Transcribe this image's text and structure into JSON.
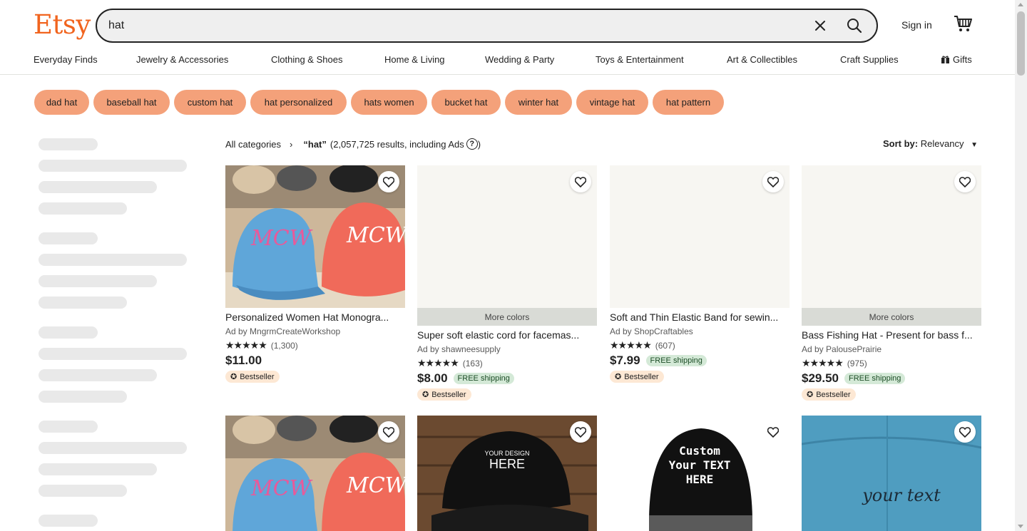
{
  "header": {
    "logo": "Etsy",
    "search_value": "hat",
    "sign_in": "Sign in"
  },
  "nav": [
    "Everyday Finds",
    "Jewelry & Accessories",
    "Clothing & Shoes",
    "Home & Living",
    "Wedding & Party",
    "Toys & Entertainment",
    "Art & Collectibles",
    "Craft Supplies",
    "Gifts"
  ],
  "chips": [
    "dad hat",
    "baseball hat",
    "custom hat",
    "hat personalized",
    "hats women",
    "bucket hat",
    "winter hat",
    "vintage hat",
    "hat pattern"
  ],
  "breadcrumb": {
    "all": "All categories",
    "query": "“hat”",
    "results": "(2,057,725 results, including Ads",
    "help": "?",
    "close": ")"
  },
  "sort": {
    "label": "Sort by:",
    "value": "Relevancy"
  },
  "products": [
    {
      "title": "Personalized Women Hat Monogra...",
      "shop": "Ad by MngrmCreateWorkshop",
      "stars": "★★★★★",
      "reviews": "(1,300)",
      "price": "$11.00",
      "free": "",
      "badge": "Bestseller",
      "more": ""
    },
    {
      "title": "Super soft elastic cord for facemas...",
      "shop": "Ad by shawneesupply",
      "stars": "★★★★★",
      "reviews": "(163)",
      "price": "$8.00",
      "free": "FREE shipping",
      "badge": "Bestseller",
      "more": "More colors"
    },
    {
      "title": "Soft and Thin Elastic Band for sewin...",
      "shop": "Ad by ShopCraftables",
      "stars": "★★★★★",
      "reviews": "(607)",
      "price": "$7.99",
      "free": "FREE shipping",
      "badge": "Bestseller",
      "more": ""
    },
    {
      "title": "Bass Fishing Hat - Present for bass f...",
      "shop": "Ad by PalousePrairie",
      "stars": "★★★★★",
      "reviews": "(975)",
      "price": "$29.50",
      "free": "FREE shipping",
      "badge": "Bestseller",
      "more": "More colors"
    }
  ],
  "row2": {
    "design_top": "YOUR DESIGN",
    "design_main": "HERE",
    "custom_lines": [
      "Custom",
      "Your TEXT",
      "HERE"
    ],
    "your_text": "your text"
  },
  "colors": {
    "brand": "#f1641e",
    "chip": "#f4a17a"
  }
}
